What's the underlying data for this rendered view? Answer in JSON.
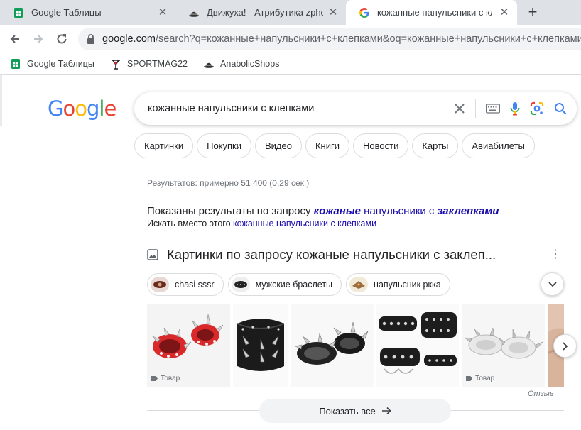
{
  "tabs": [
    {
      "title": "Google Таблицы",
      "favicon": "sheets-icon",
      "active": false
    },
    {
      "title": "Движуха! - Атрибутика zphc. Но",
      "favicon": "fedora-hat-icon",
      "active": false
    },
    {
      "title": "кожанные напульсники с клепк",
      "favicon": "google-g-icon",
      "active": true
    }
  ],
  "toolbar": {
    "url_host": "google.com",
    "url_rest": "/search?q=кожанные+напульсники+с+клепками&oq=кожанные+напульсники+с+клепками&"
  },
  "bookmarks": [
    {
      "label": "Google Таблицы",
      "icon": "sheets-icon"
    },
    {
      "label": "SPORTMAG22",
      "icon": "sportmag-icon"
    },
    {
      "label": "AnabolicShops",
      "icon": "fedora-hat-icon"
    }
  ],
  "google": {
    "logo": "Google",
    "query": "кожанные напульсники с клепками"
  },
  "chips": [
    "Картинки",
    "Покупки",
    "Видео",
    "Книги",
    "Новости",
    "Карты",
    "Авиабилеты"
  ],
  "results": {
    "stats": "Результатов: примерно 51 400 (0,29 сек.)",
    "spell_prefix": "Показаны результаты по запросу ",
    "spell_word1": "кожаные",
    "spell_mid": " напульсники с ",
    "spell_word2": "заклепками",
    "instead_prefix": "Искать вместо этого ",
    "instead_link": "кожанные напульсники с клепками"
  },
  "images_block": {
    "title": "Картинки по запросу кожаные напульсники с заклеп...",
    "filters": [
      "chasi sssr",
      "мужские браслеты",
      "напульсник ркка"
    ],
    "badge": "Товар",
    "feedback": "Отзыв",
    "show_all": "Показать все"
  },
  "colors": {
    "link": "#1a0dab",
    "tabstrip": "#dee1e6",
    "google_blue": "#4285f4",
    "google_red": "#ea4335",
    "google_yellow": "#fbbc05",
    "google_green": "#34a853"
  }
}
